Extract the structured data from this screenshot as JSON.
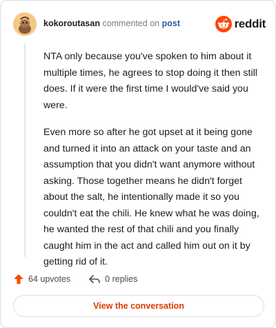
{
  "header": {
    "username": "kokoroutasan",
    "action": " commented on ",
    "target": "post",
    "brand": "reddit"
  },
  "comment": {
    "paragraphs": [
      "NTA only because you've spoken to him about it multiple times, he agrees to stop doing it then still does. If it were the first time I would've said you were.",
      "Even more so after he got upset at it being gone and turned it into an attack on your taste and an assumption that you didn't want anymore without asking. Those together means he didn't forget about the salt, he intentionally made it so you couldn't eat the chili. He knew what he was doing, he wanted the rest of that chili and you finally caught him in the act and called him out on it by getting rid of it."
    ]
  },
  "footer": {
    "upvotes": "64 upvotes",
    "replies": "0 replies"
  },
  "cta": {
    "label": "View the conversation"
  },
  "colors": {
    "accent": "#ff4500",
    "link": "#2b5aa8",
    "cta_text": "#d93a00"
  },
  "icons": {
    "avatar": "snoo-avatar",
    "logo": "reddit-snoo-icon",
    "upvote": "upvote-arrow-icon",
    "reply": "reply-arrow-icon"
  }
}
